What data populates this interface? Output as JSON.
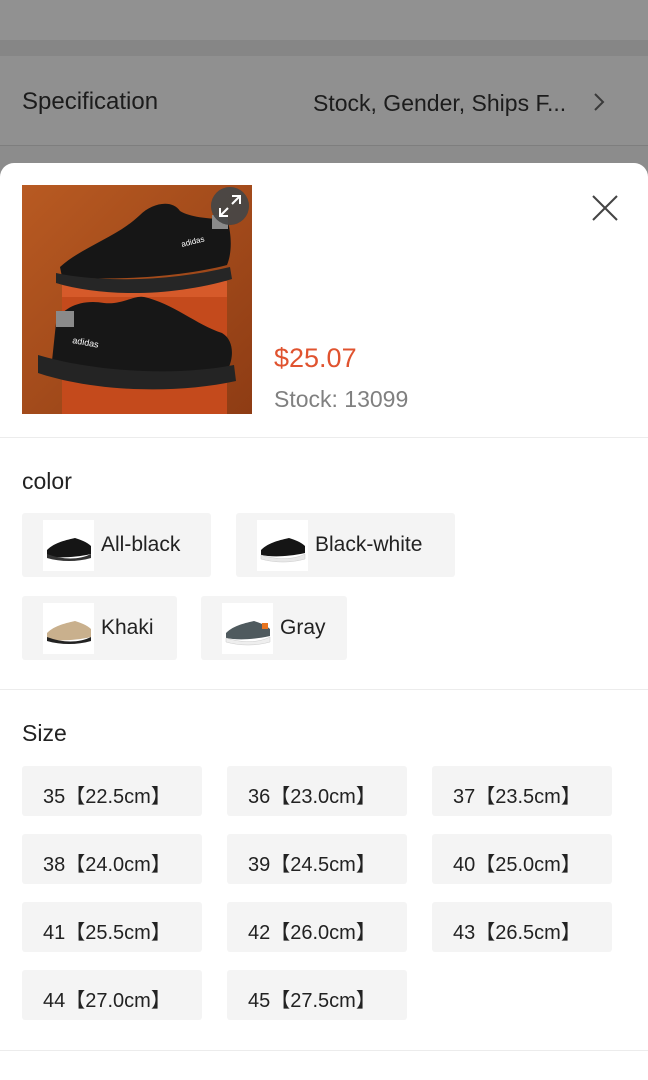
{
  "background": {
    "spec_label": "Specification",
    "spec_value": "Stock, Gender, Ships F..."
  },
  "product": {
    "price": "$25.07",
    "stock": "Stock: 13099",
    "image_brand_text": "adidas"
  },
  "color_section": {
    "title": "color",
    "options": [
      {
        "label": "All-black"
      },
      {
        "label": "Black-white"
      },
      {
        "label": "Khaki"
      },
      {
        "label": "Gray"
      }
    ]
  },
  "size_section": {
    "title": "Size",
    "options": [
      {
        "label": "35【22.5cm】"
      },
      {
        "label": "36【23.0cm】"
      },
      {
        "label": "37【23.5cm】"
      },
      {
        "label": "38【24.0cm】"
      },
      {
        "label": "39【24.5cm】"
      },
      {
        "label": "40【25.0cm】"
      },
      {
        "label": "41【25.5cm】"
      },
      {
        "label": "42【26.0cm】"
      },
      {
        "label": "43【26.5cm】"
      },
      {
        "label": "44【27.0cm】"
      },
      {
        "label": "45【27.5cm】"
      }
    ]
  },
  "colors": {
    "price": "#e0532f",
    "chip_bg": "#f4f4f4",
    "overlay": "#8f8f8f"
  }
}
